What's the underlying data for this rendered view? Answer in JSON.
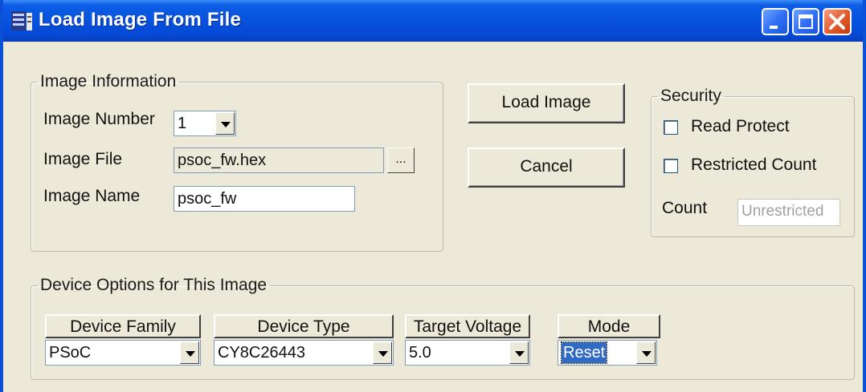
{
  "window": {
    "title": "Load Image From File"
  },
  "image_info": {
    "legend": "Image Information",
    "image_number_label": "Image Number",
    "image_number_value": "1",
    "image_file_label": "Image File",
    "image_file_value": "psoc_fw.hex",
    "browse_label": "...",
    "image_name_label": "Image Name",
    "image_name_value": "psoc_fw"
  },
  "buttons": {
    "load_image": "Load Image",
    "cancel": "Cancel"
  },
  "security": {
    "legend": "Security",
    "read_protect_label": "Read Protect",
    "read_protect_checked": false,
    "restricted_count_label": "Restricted Count",
    "restricted_count_checked": false,
    "count_label": "Count",
    "count_value": "Unrestricted"
  },
  "device_options": {
    "legend": "Device Options for This Image",
    "device_family": {
      "header": "Device Family",
      "value": "PSoC"
    },
    "device_type": {
      "header": "Device Type",
      "value": "CY8C26443"
    },
    "target_voltage": {
      "header": "Target Voltage",
      "value": "5.0"
    },
    "mode": {
      "header": "Mode",
      "value": "Reset"
    }
  }
}
